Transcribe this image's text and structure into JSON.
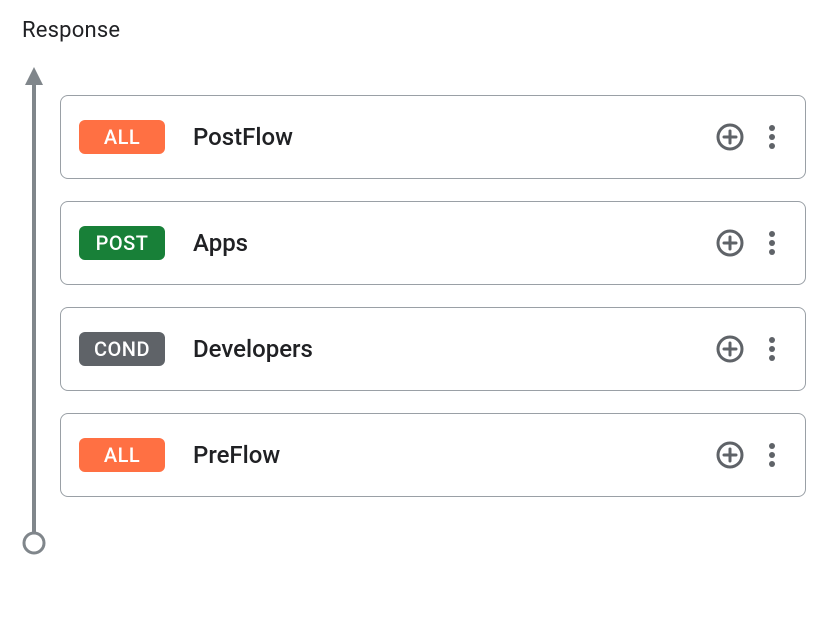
{
  "section": {
    "title": "Response"
  },
  "tagColors": {
    "ALL": "tag-orange",
    "POST": "tag-green",
    "COND": "tag-gray"
  },
  "flows": [
    {
      "tag": "ALL",
      "name": "PostFlow"
    },
    {
      "tag": "POST",
      "name": "Apps"
    },
    {
      "tag": "COND",
      "name": "Developers"
    },
    {
      "tag": "ALL",
      "name": "PreFlow"
    }
  ]
}
